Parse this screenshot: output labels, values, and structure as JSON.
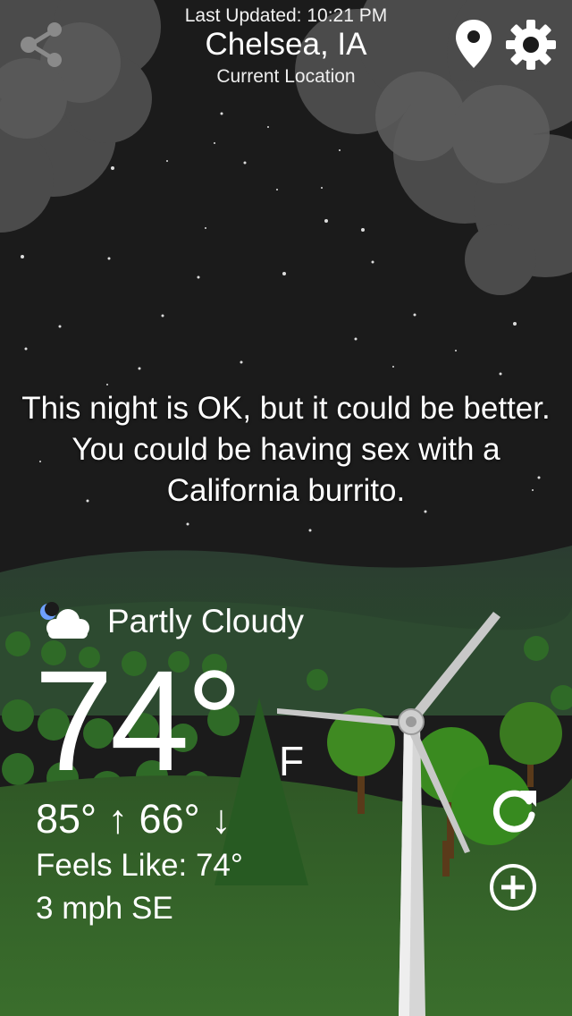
{
  "header": {
    "last_updated": "Last Updated: 10:21 PM",
    "city": "Chelsea, IA",
    "location_label": "Current Location"
  },
  "phrase": "This night is OK, but it could be better. You could be having sex with a California burrito.",
  "current": {
    "condition": "Partly Cloudy",
    "condition_icon": "partly-cloudy-night-icon",
    "temperature": "74°",
    "unit": "F",
    "high_low": "85° ↑ 66° ↓",
    "feels_like": "Feels Like: 74°",
    "wind": "3 mph SE"
  },
  "icons": {
    "share": "share-icon",
    "location": "location-pin-icon",
    "settings": "gear-icon",
    "refresh": "refresh-icon",
    "add": "add-circle-icon"
  },
  "colors": {
    "sky": "#1b1b1b",
    "hills": "#2a4030",
    "grass": "#2f5a26",
    "tree": "#3e8a22",
    "text": "#ffffff"
  }
}
